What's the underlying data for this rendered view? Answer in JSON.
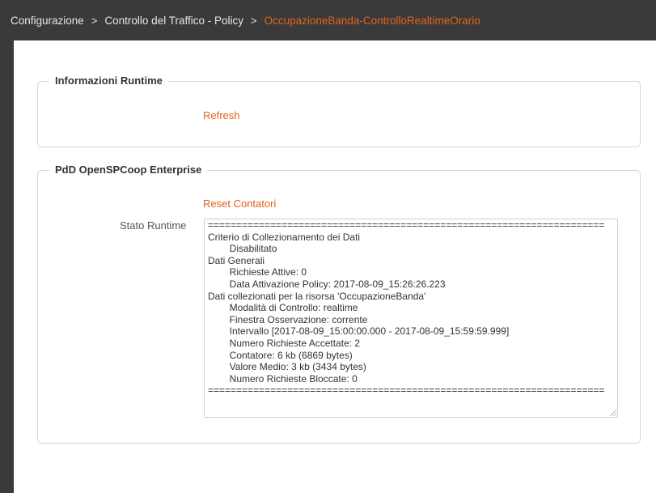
{
  "breadcrumb": {
    "items": [
      "Configurazione",
      "Controllo del Traffico - Policy"
    ],
    "current": "OccupazioneBanda-ControlloRealtimeOrario",
    "separator": ">"
  },
  "runtime_info": {
    "legend": "Informazioni Runtime",
    "refresh_label": "Refresh"
  },
  "pdd_section": {
    "legend": "PdD OpenSPCoop Enterprise",
    "reset_label": "Reset Contatori",
    "stato_label": "Stato Runtime",
    "stato_text": "======================================================================\nCriterio di Collezionamento dei Dati\n        Disabilitato\nDati Generali\n        Richieste Attive: 0\n        Data Attivazione Policy: 2017-08-09_15:26:26.223\nDati collezionati per la risorsa 'OccupazioneBanda'\n        Modalità di Controllo: realtime\n        Finestra Osservazione: corrente\n        Intervallo [2017-08-09_15:00:00.000 - 2017-08-09_15:59:59.999]\n        Numero Richieste Accettate: 2\n        Contatore: 6 kb (6869 bytes)\n        Valore Medio: 3 kb (3434 bytes)\n        Numero Richieste Bloccate: 0\n======================================================================"
  },
  "colors": {
    "header_bg": "#3a3a3a",
    "accent": "#e2621b",
    "border": "#d4d4d4"
  }
}
